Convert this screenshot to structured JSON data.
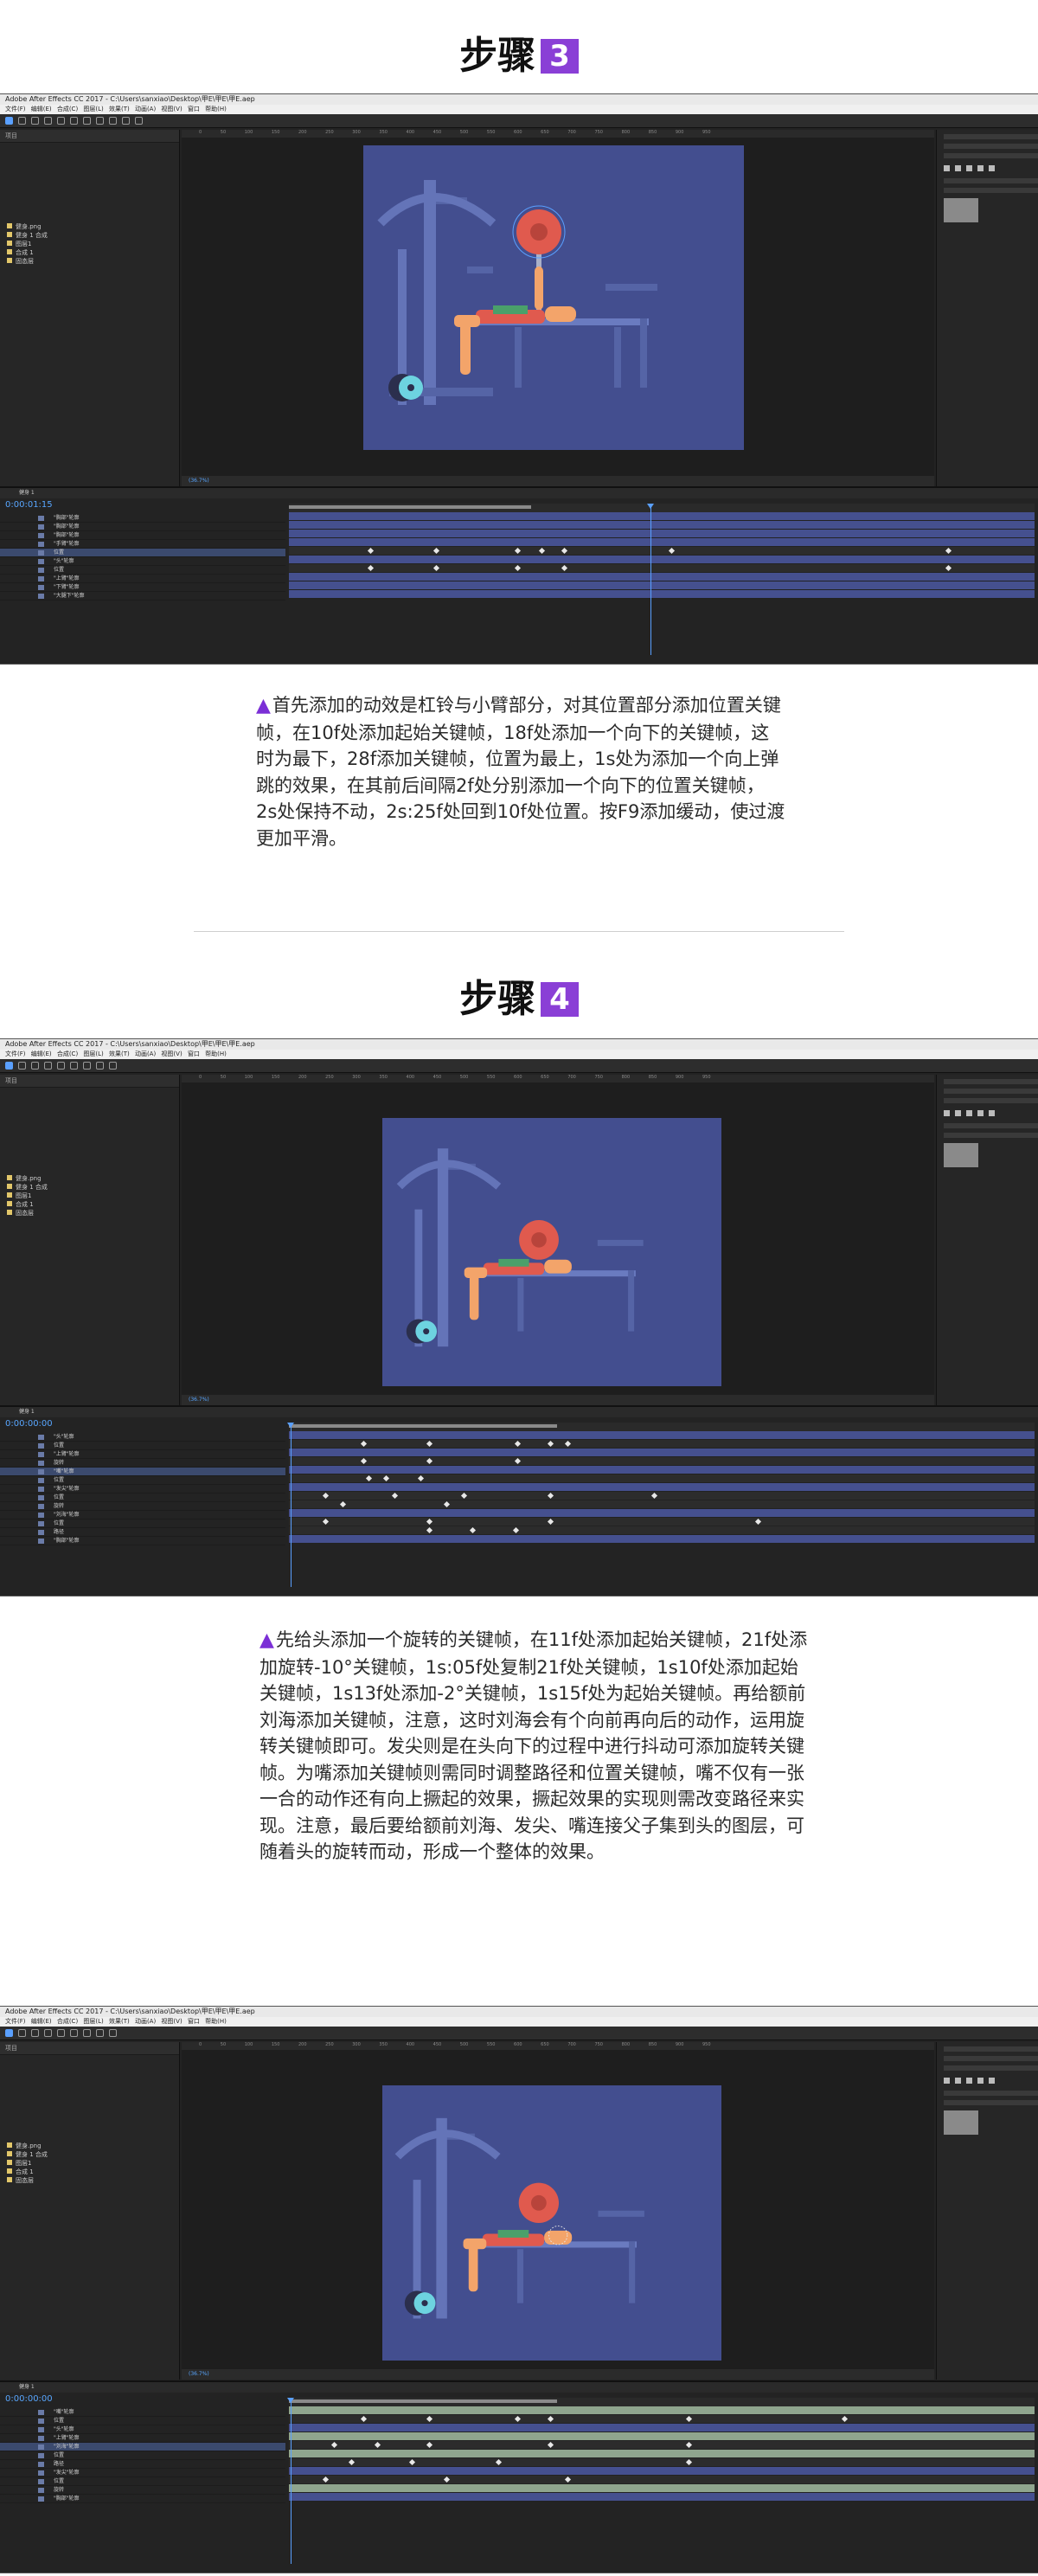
{
  "steps": [
    {
      "heading_text": "步骤",
      "number": "3"
    },
    {
      "heading_text": "步骤",
      "number": "4"
    }
  ],
  "app": {
    "title": "Adobe After Effects CC 2017 - C:\\Users\\sanxiao\\Desktop\\甲E\\甲E\\甲E.aep",
    "menu": "文件(F)  编辑(E)  合成(C)  图层(L)  效果(T)  动画(A)  视图(V)  窗口  帮助(H)",
    "panel_project": "项目",
    "timecode_a": "0:00:01:15",
    "timecode_b": "0:00:00:00",
    "zoom": "(36.7%)",
    "project_items": [
      "健身.png",
      "健身 1 合成",
      "图层1",
      "合成 1",
      "固态层"
    ],
    "layers_a": [
      "\"胸部\"轮廓",
      "\"胸部\"轮廓",
      "\"胸部\"轮廓",
      "\"手臂\"轮廓",
      "位置",
      "\"头\"轮廓",
      "位置",
      "\"上臂\"轮廓",
      "\"下臂\"轮廓",
      "\"大腿下\"轮廓"
    ],
    "layers_b": [
      "\"头\"轮廓",
      "位置",
      "\"上臂\"轮廓",
      "旋转",
      "\"嘴\"轮廓",
      "位置",
      "\"发尖\"轮廓",
      "位置",
      "旋转",
      "\"刘海\"轮廓",
      "位置",
      "路径",
      "\"胸部\"轮廓"
    ]
  },
  "desc3": "首先添加的动效是杠铃与小臂部分，对其位置部分添加位置关键帧，在10f处添加起始关键帧，18f处添加一个向下的关键帧，这时为最下，28f添加关键帧，位置为最上，1s处为添加一个向上弹跳的效果，在其前后间隔2f处分别添加一个向下的位置关键帧，2s处保持不动，2s:25f处回到10f处位置。按F9添加缓动，使过渡更加平滑。",
  "desc4": "先给头添加一个旋转的关键帧，在11f处添加起始关键帧，21f处添加旋转-10°关键帧，1s:05f处复制21f处关键帧，1s10f处添加起始关键帧，1s13f处添加-2°关键帧，1s15f处为起始关键帧。再给额前刘海添加关键帧，注意，这时刘海会有个向前再向后的动作，运用旋转关键帧即可。发尖则是在头向下的过程中进行抖动可添加旋转关键帧。为嘴添加关键帧则需同时调整路径和位置关键帧，嘴不仅有一张一合的动作还有向上撅起的效果，撅起效果的实现则需改变路径来实现。注意，最后要给额前刘海、发尖、嘴连接父子集到头的图层，可随着头的旋转而动，形成一个整体的效果。"
}
